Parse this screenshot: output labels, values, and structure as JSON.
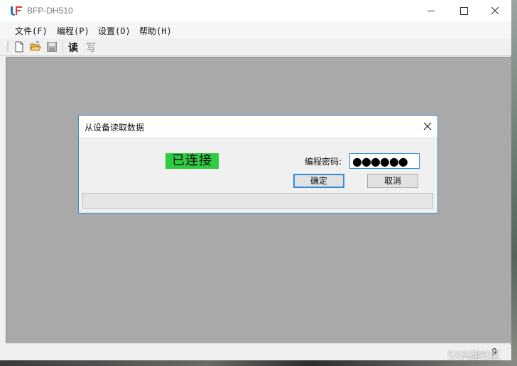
{
  "window": {
    "title": "BFP-DH510",
    "controls": {
      "minimize": "minimize",
      "maximize": "maximize",
      "close": "close"
    }
  },
  "menu": {
    "items": [
      {
        "label": "文件(F)"
      },
      {
        "label": "编程(P)"
      },
      {
        "label": "设置(O)"
      },
      {
        "label": "帮助(H)"
      }
    ]
  },
  "toolbar": {
    "icons": [
      "new-file-icon",
      "open-folder-icon",
      "save-icon"
    ],
    "read_label": "读",
    "write_label": "写"
  },
  "dialog": {
    "title": "从设备读取数据",
    "status_text": "已连接",
    "status_color": "#2ecc40",
    "password_label": "编程密码:",
    "password_value": "●●●●●●",
    "ok_label": "确定",
    "cancel_label": "取消",
    "progress": 0
  },
  "statusbar": {
    "value": "9"
  },
  "overlay": {
    "watermark": "5X兴趣社区"
  },
  "colors": {
    "accent": "#2f8ad8",
    "workspace": "#a9a9a9"
  }
}
